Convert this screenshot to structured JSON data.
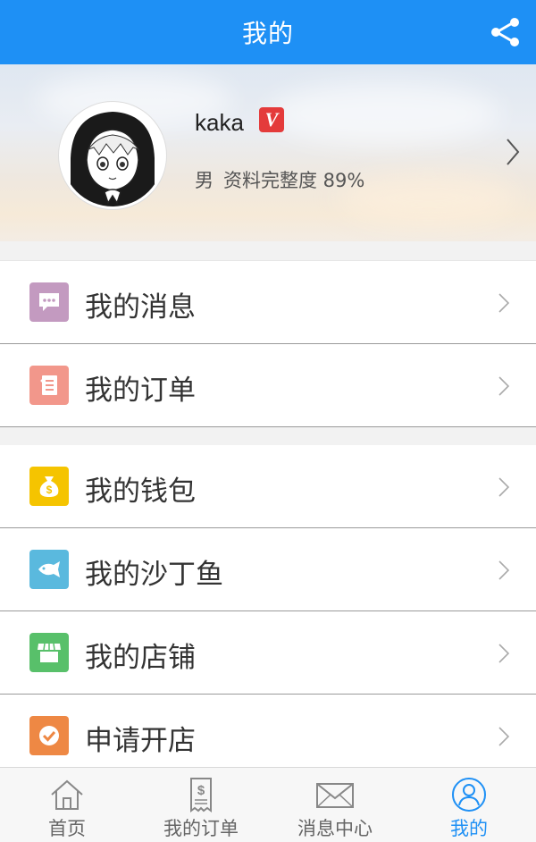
{
  "header": {
    "title": "我的",
    "share_icon": "share-icon"
  },
  "profile": {
    "username": "kaka",
    "verified_badge": "V",
    "gender": "男",
    "completeness": "资料完整度 89%"
  },
  "menu_group_1": [
    {
      "label": "我的消息",
      "icon": "message-icon",
      "color": "#c39ac0"
    },
    {
      "label": "我的订单",
      "icon": "order-list-icon",
      "color": "#f2978b"
    }
  ],
  "menu_group_2": [
    {
      "label": "我的钱包",
      "icon": "money-bag-icon",
      "color": "#f5c400"
    },
    {
      "label": "我的沙丁鱼",
      "icon": "fish-icon",
      "color": "#5ab9de"
    },
    {
      "label": "我的店铺",
      "icon": "store-icon",
      "color": "#58c06a"
    },
    {
      "label": "申请开店",
      "icon": "check-icon",
      "color": "#ee8844"
    }
  ],
  "tabbar": [
    {
      "label": "首页",
      "icon": "home-icon",
      "active": false
    },
    {
      "label": "我的订单",
      "icon": "receipt-icon",
      "active": false
    },
    {
      "label": "消息中心",
      "icon": "envelope-icon",
      "active": false
    },
    {
      "label": "我的",
      "icon": "user-icon",
      "active": true
    }
  ],
  "colors": {
    "primary": "#1e90f5",
    "divider": "#9a9a9a"
  }
}
